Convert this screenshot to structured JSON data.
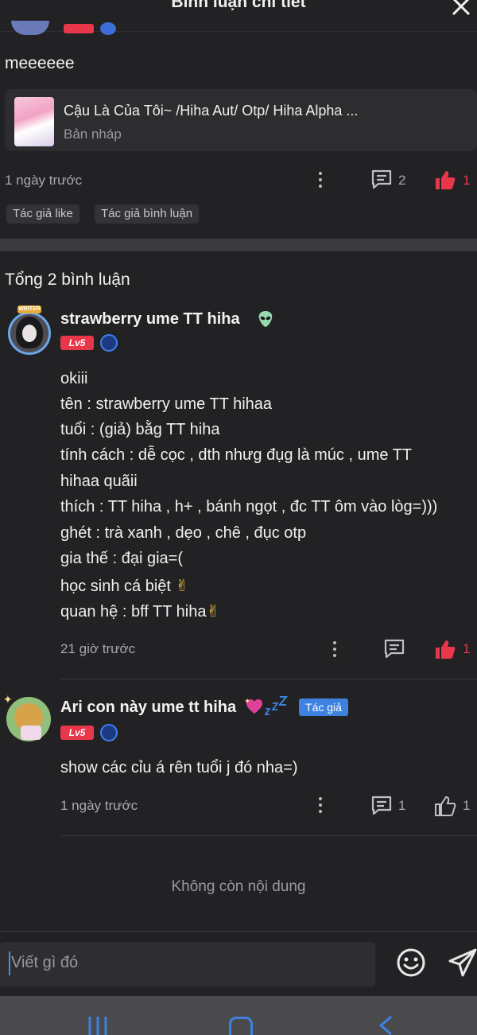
{
  "header": {
    "title": "Bình luận chi tiết"
  },
  "post": {
    "text": "meeeeee",
    "draft": {
      "title": "Cậu Là Của Tôi~ /Hiha Aut/ Otp/ Hiha Alpha ...",
      "status": "Bản nháp"
    },
    "time": "1 ngày trước",
    "comment_count": "2",
    "like_count": "1",
    "tags": [
      "Tác giả like",
      "Tác giả bình luận"
    ]
  },
  "comments_section": {
    "total_label": "Tổng 2 bình luận"
  },
  "comments": [
    {
      "name": "strawberry ume TT hiha",
      "level": "Lv5",
      "frame_label": "WRITER",
      "lines": [
        "okiii",
        "tên : strawberry ume TT hihaa",
        "tuổi : (giả) bằg TT hiha",
        "tính cách : dễ cọc , dth nhưg đụg là múc , ume TT",
        "hihaa quãii",
        "thích : TT hiha , h+ , bánh ngọt , đc TT ôm vào lòg=)))",
        "ghét : trà xanh , dẹo , chê , đục otp",
        "gia thế : đại gia=(",
        "học sinh cá biệt",
        "quan hệ : bff TT hiha"
      ],
      "time": "21 giờ trước",
      "like_count": "1"
    },
    {
      "name": "Ari con này ume tt hiha",
      "level": "Lv5",
      "author_tag": "Tác giả",
      "lines": [
        "show các cỉu á rên tuổi j đó nha=)"
      ],
      "time": "1 ngày trước",
      "reply_count": "1",
      "like_count": "1"
    }
  ],
  "footer": {
    "no_more": "Không còn nội dung"
  },
  "composer": {
    "placeholder": "Viết gì đó"
  },
  "colors": {
    "accent_red": "#e8374a",
    "accent_blue": "#3d82e0",
    "background": "#222224"
  }
}
